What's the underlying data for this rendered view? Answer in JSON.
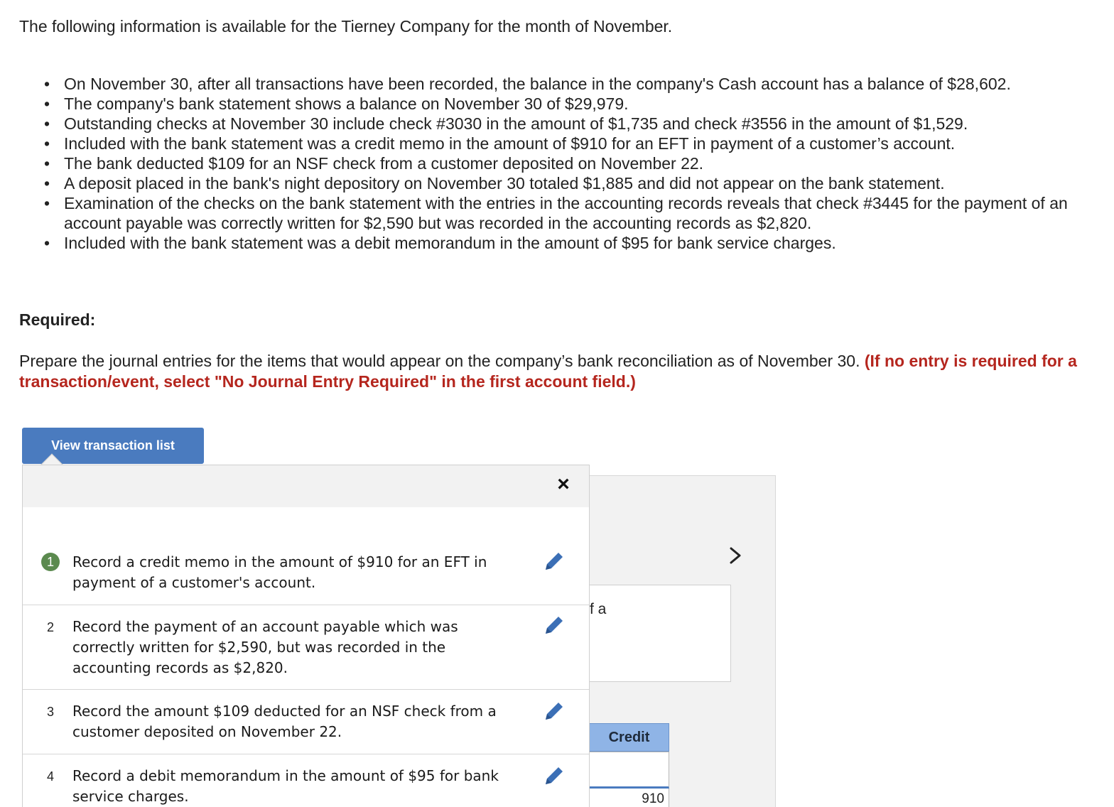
{
  "intro": "The following information is available for the Tierney Company for the month of November.",
  "bullets": [
    "On November 30, after all transactions have been recorded, the balance in the company's Cash account has a balance of $28,602.",
    "The company's bank statement shows a balance on November 30 of $29,979.",
    "Outstanding checks at November 30 include check #3030 in the amount of $1,735 and check #3556 in the amount of $1,529.",
    "Included with the bank statement was a credit memo in the amount of $910 for an EFT in payment of a customer’s account.",
    "The bank deducted $109 for an NSF check from a customer deposited on November 22.",
    "A deposit placed in the bank's night depository on November 30 totaled $1,885 and did not appear on the bank statement.",
    "Examination of the checks on the bank statement with the entries in the accounting records reveals that check #3445 for the payment of an account payable was correctly written for $2,590 but was recorded in the accounting records as $2,820.",
    "Included with the bank statement was a debit memorandum in the amount of $95 for bank service charges."
  ],
  "required_heading": "Required:",
  "instructions": {
    "text": "Prepare the journal entries for the items that would appear on the company’s bank reconciliation as of November 30.",
    "note": "(If no entry is required for a transaction/event, select \"No Journal Entry Required\" in the first account field.)"
  },
  "view_button_label": "View transaction list",
  "popup": {
    "close_label": "×",
    "transactions": [
      {
        "num": "1",
        "text": "Record a credit memo in the amount of $910 for an EFT in payment of a customer's account.",
        "active": true
      },
      {
        "num": "2",
        "text": "Record the payment of an account payable which was correctly written for $2,590, but was recorded in the accounting records as $2,820.",
        "active": false
      },
      {
        "num": "3",
        "text": "Record the amount $109 deducted for an NSF check from a customer deposited on November 22.",
        "active": false
      },
      {
        "num": "4",
        "text": "Record a debit memorandum in the amount of $95 for bank service charges.",
        "active": false
      }
    ]
  },
  "background": {
    "partial_text": "f a",
    "credit_header": "Credit",
    "credit_value": "910"
  },
  "colors": {
    "button_blue": "#4a7bbf",
    "note_red": "#b5261e",
    "active_green": "#5b8a4f",
    "edit_icon_blue": "#3b6fb6",
    "credit_header_bg": "#8fb4e6"
  }
}
